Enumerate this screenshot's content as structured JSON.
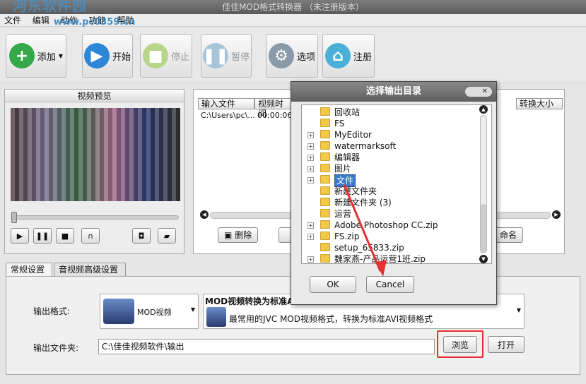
{
  "window": {
    "title": "佳佳MOD格式转换器  （未注册版本）",
    "watermark": "河东软件园",
    "watermark_url": "www.pc0359.cn"
  },
  "menu": [
    "文件",
    "编辑",
    "动作",
    "功能",
    "帮助"
  ],
  "toolbar": {
    "add": "添加",
    "start": "开始",
    "stop": "停止",
    "pause": "暂停",
    "options": "选项",
    "register": "注册"
  },
  "preview": {
    "title": "视频预览"
  },
  "list": {
    "columns": [
      "输入文件",
      "视频时间",
      "转换大小"
    ],
    "row": {
      "file": "C:\\Users\\pc\\...",
      "time": "00:00:06"
    },
    "delete": "删除",
    "rename": "命名"
  },
  "tabs": [
    "常规设置",
    "音视频高级设置"
  ],
  "settings": {
    "format_label": "输出格式:",
    "format_value": "MOD视频",
    "format_title": "MOD视频转换为标准A",
    "format_desc": "最常用的JVC MOD视频格式，转换为标准AVI视频格式",
    "folder_label": "输出文件夹:",
    "folder_value": "C:\\佳佳视频软件\\输出",
    "browse": "浏览",
    "open": "打开"
  },
  "dialog": {
    "title": "选择输出目录",
    "close": "✕",
    "items": [
      {
        "name": "回收站",
        "expand": false
      },
      {
        "name": "FS",
        "expand": false
      },
      {
        "name": "MyEditor",
        "expand": true
      },
      {
        "name": "watermarksoft",
        "expand": true
      },
      {
        "name": "编辑器",
        "expand": true
      },
      {
        "name": "图片",
        "expand": true
      },
      {
        "name": "文件",
        "expand": true,
        "selected": true
      },
      {
        "name": "新建文件夹",
        "expand": false
      },
      {
        "name": "新建文件夹 (3)",
        "expand": false
      },
      {
        "name": "运营",
        "expand": false
      },
      {
        "name": "Adobe Photoshop CC.zip",
        "expand": true
      },
      {
        "name": "FS.zip",
        "expand": true
      },
      {
        "name": "setup_65833.zip",
        "expand": false
      },
      {
        "name": "魏家燕-产品运营1班.zip",
        "expand": true
      }
    ],
    "ok": "OK",
    "cancel": "Cancel"
  },
  "colors": {
    "highlight": "#e53030",
    "selection": "#3b78d0"
  }
}
